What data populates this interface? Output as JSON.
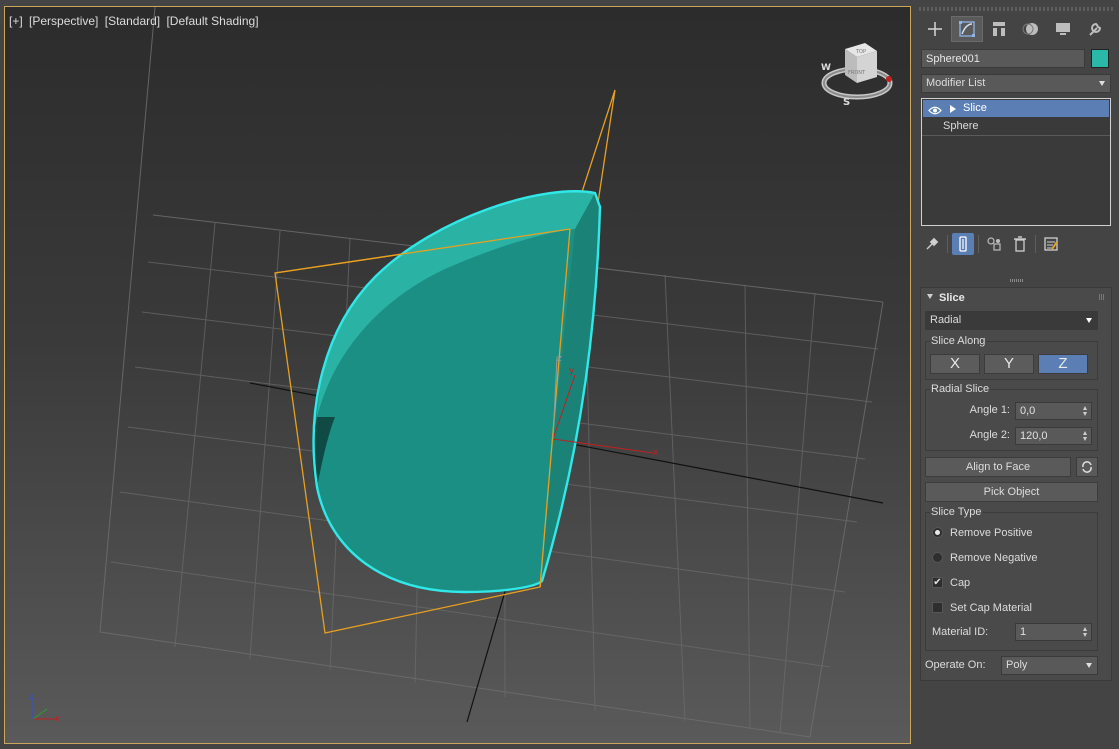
{
  "viewport": {
    "labels": [
      "[+]",
      "[Perspective]",
      "[Standard]",
      "[Default Shading]"
    ],
    "viewcube": {
      "top": "TOP",
      "front": "FRONT",
      "compass": [
        "W",
        "S"
      ]
    },
    "gizmo_axes": [
      "x",
      "y",
      "z"
    ],
    "colors": {
      "object": "#1fa89a",
      "selection_outline": "#30e8e8",
      "slice_plane": "#e8a020"
    }
  },
  "command_panel": {
    "tabs": [
      "create-icon",
      "modify-icon",
      "hierarchy-icon",
      "motion-icon",
      "display-icon",
      "utilities-icon"
    ],
    "object_name": "Sphere001",
    "object_color": "#2ab8a8",
    "modifier_list": "Modifier List",
    "stack": [
      {
        "label": "Slice",
        "selected": true
      },
      {
        "label": "Sphere",
        "selected": false
      }
    ],
    "stack_tools": [
      "pin-stack-icon",
      "show-end-result-icon",
      "make-unique-icon",
      "remove-modifier-icon",
      "configure-sets-icon"
    ]
  },
  "slice": {
    "title": "Slice",
    "mode": "Radial",
    "slice_along": {
      "label": "Slice Along",
      "axes": [
        "X",
        "Y",
        "Z"
      ],
      "active": "Z"
    },
    "radial_slice": {
      "label": "Radial Slice",
      "angle1_label": "Angle 1:",
      "angle1": "0,0",
      "angle2_label": "Angle 2:",
      "angle2": "120,0"
    },
    "align_to_face": "Align to Face",
    "pick_object": "Pick Object",
    "slice_type": {
      "label": "Slice Type",
      "remove_positive": "Remove Positive",
      "remove_negative": "Remove Negative",
      "selected": "Remove Positive",
      "cap": "Cap",
      "cap_checked": true,
      "set_cap_material": "Set Cap Material",
      "set_cap_material_checked": false,
      "material_id_label": "Material  ID:",
      "material_id": "1"
    },
    "operate_on_label": "Operate On:",
    "operate_on": "Poly"
  }
}
